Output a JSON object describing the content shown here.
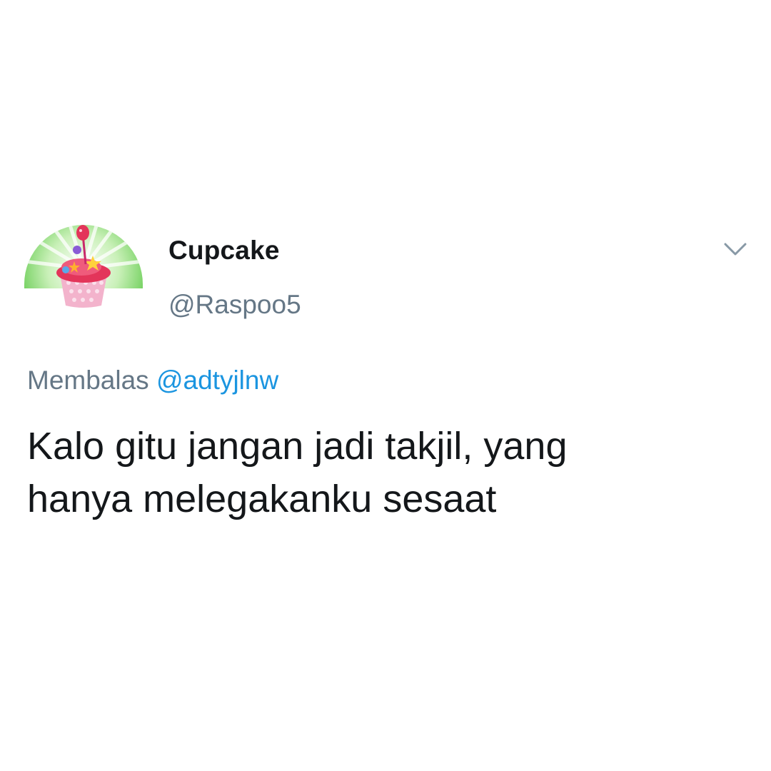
{
  "tweet": {
    "display_name": "Cupcake",
    "handle": "@Raspoo5",
    "reply_prefix": "Membalas",
    "reply_mention": "@adtyjlnw",
    "text_lines": [
      "Kalo gitu jangan jadi takjil, yang",
      "hanya melegakanku sesaat"
    ]
  },
  "icons": {
    "avatar": "cupcake-avatar-icon",
    "menu": "chevron-down-icon"
  },
  "colors": {
    "name": "#14171a",
    "secondary": "#657786",
    "link": "#1b95e0",
    "avatar_green": "#7ed36a",
    "avatar_pink": "#f0a5c4",
    "avatar_red": "#e3355a"
  }
}
